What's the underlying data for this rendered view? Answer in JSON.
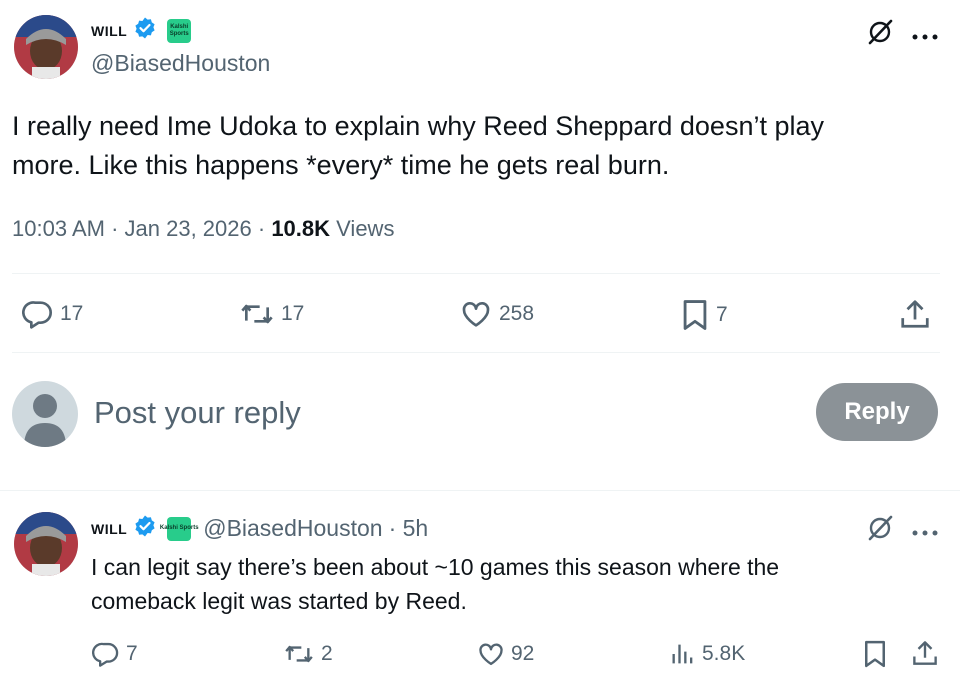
{
  "main_post": {
    "author_name": "WILL",
    "affiliate_badge": "Kalshi Sports",
    "handle": "@BiasedHouston",
    "text_line1": "I really need Ime Udoka to explain why Reed Sheppard doesn’t play",
    "text_line2": "more. Like this happens *every* time he gets real burn.",
    "time": "10:03 AM",
    "date": "Jan 23, 2026",
    "views_count": "10.8K",
    "views_label": "Views",
    "replies": "17",
    "reposts": "17",
    "likes": "258",
    "bookmarks": "7"
  },
  "composer": {
    "placeholder": "Post your reply",
    "button_label": "Reply"
  },
  "reply_post": {
    "author_name": "WILL",
    "affiliate_badge": "Kalshi Sports",
    "handle": "@BiasedHouston",
    "age": "· 5h",
    "text_line1": "I can legit say there’s been about ~10 games this season where the",
    "text_line2": "comeback legit was started by Reed.",
    "replies": "7",
    "reposts": "2",
    "likes": "92",
    "views": "5.8K"
  },
  "colors": {
    "verified": "#1d9bf0",
    "muted_text": "#536471",
    "kalshi_green": "#28cc8b",
    "reply_button": "#8b9297"
  },
  "icons": [
    "verified-badge-icon",
    "grok-icon",
    "more-icon",
    "reply-icon",
    "repost-icon",
    "like-icon",
    "bookmark-icon",
    "share-icon",
    "views-icon"
  ]
}
